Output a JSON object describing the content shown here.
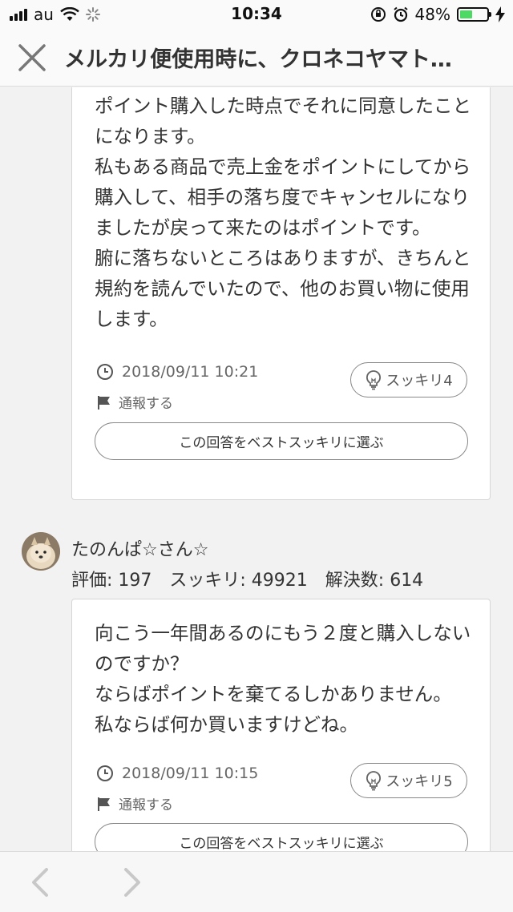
{
  "status_bar": {
    "carrier": "au",
    "time": "10:34",
    "battery_percent": "48%",
    "battery_level": 0.48
  },
  "header": {
    "title": "メルカリ便使用時に、クロネコヤマト…"
  },
  "answers": [
    {
      "body": "ポイント購入した時点でそれに同意したことになります。\n私もある商品で売上金をポイントにしてから購入して、相手の落ち度でキャンセルになりましたが戻って来たのはポイントです。\n腑に落ちないところはありますが、きちんと規約を読んでいたので、他のお買い物に使用します。",
      "timestamp": "2018/09/11 10:21",
      "report_label": "通報する",
      "sukkiri_label": "スッキリ4",
      "best_button_label": "この回答をベストスッキリに選ぶ"
    },
    {
      "answerer_name": "たのんぱ☆さん☆",
      "answerer_stats": "評価: 197　スッキリ: 49921　解決数: 614",
      "body": "向こう一年間あるのにもう２度と購入しないのですか？\nならばポイントを棄てるしかありません。\n私ならば何か買いますけどね。",
      "timestamp": "2018/09/11 10:15",
      "report_label": "通報する",
      "sukkiri_label": "スッキリ5",
      "best_button_label": "この回答をベストスッキリに選ぶ"
    }
  ],
  "icons": {
    "close": "close-icon",
    "clock": "clock-icon",
    "flag": "flag-icon",
    "bulb": "lightbulb-icon",
    "back": "chevron-left-icon",
    "forward": "chevron-right-icon"
  },
  "colors": {
    "battery": "#4cd964",
    "border": "#d6d6d6",
    "background": "#f2f2f2"
  }
}
